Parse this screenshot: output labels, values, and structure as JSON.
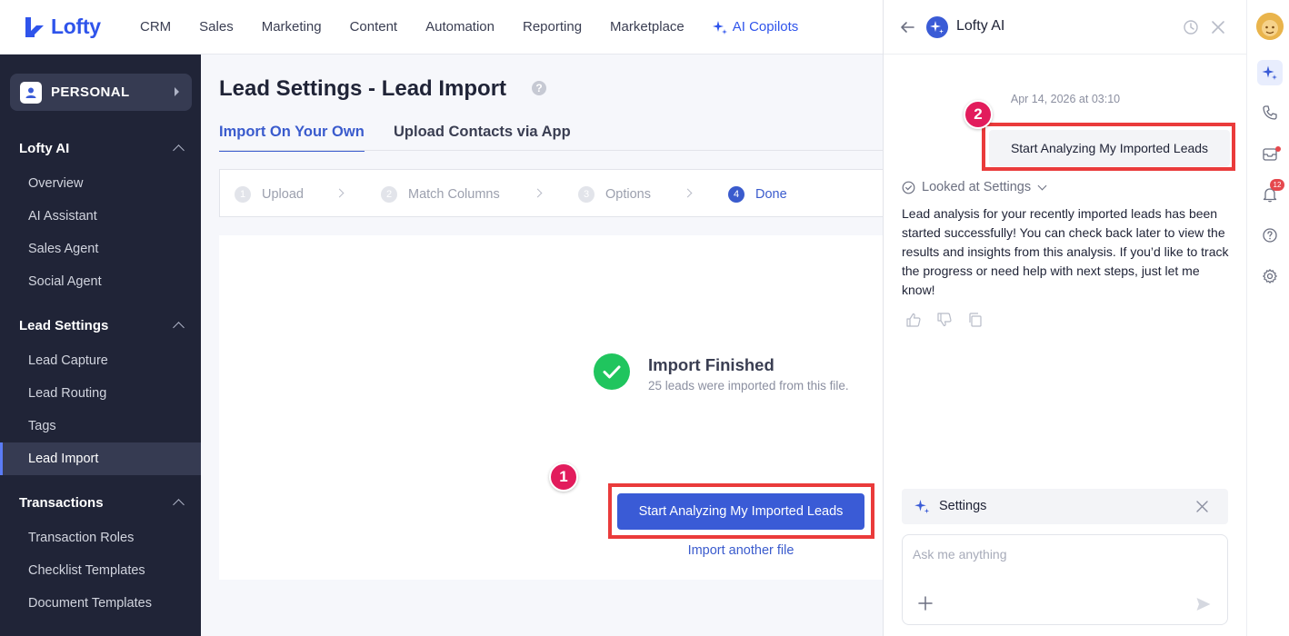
{
  "topnav": {
    "logo_text": "Lofty",
    "items": [
      "CRM",
      "Sales",
      "Marketing",
      "Content",
      "Automation",
      "Reporting",
      "Marketplace"
    ],
    "ai_label": "AI Copilots"
  },
  "sidebar": {
    "workspace_label": "PERSONAL",
    "sections": [
      {
        "title": "Lofty AI",
        "items": [
          "Overview",
          "AI Assistant",
          "Sales Agent",
          "Social Agent"
        ]
      },
      {
        "title": "Lead Settings",
        "items": [
          "Lead Capture",
          "Lead Routing",
          "Tags",
          "Lead Import"
        ]
      },
      {
        "title": "Transactions",
        "items": [
          "Transaction Roles",
          "Checklist Templates",
          "Document Templates"
        ]
      }
    ],
    "active_item": "Lead Import"
  },
  "main": {
    "title": "Lead Settings - Lead Import",
    "help": "?",
    "tabs": [
      "Import On Your Own",
      "Upload Contacts via App"
    ],
    "steps": [
      {
        "num": "1",
        "label": "Upload"
      },
      {
        "num": "2",
        "label": "Match Columns"
      },
      {
        "num": "3",
        "label": "Options"
      },
      {
        "num": "4",
        "label": "Done"
      }
    ],
    "finish_title": "Import Finished",
    "finish_sub": "25 leads were imported from this file.",
    "primary_button": "Start Analyzing My Imported Leads",
    "link": "Import another file"
  },
  "markers": {
    "one": "1",
    "two": "2"
  },
  "ai_panel": {
    "title": "Lofty AI",
    "timestamp": "Apr 14, 2026 at 03:10",
    "user_message": "Start Analyzing My Imported Leads",
    "looked_label": "Looked at Settings",
    "response": "Lead analysis for your recently imported leads has been started successfully! You can check back later to view the results and insights from this analysis. If you’d like to track the progress or need help with next steps, just let me know!",
    "context_chip": "Settings",
    "input_placeholder": "Ask me anything"
  },
  "rail": {
    "notification_count": "12"
  },
  "colors": {
    "brand": "#2f54eb",
    "primary_button": "#3a5bd6",
    "sidebar_bg": "#202437",
    "highlight": "#ea3b3b",
    "marker": "#e21c5c",
    "success": "#20c55e"
  }
}
